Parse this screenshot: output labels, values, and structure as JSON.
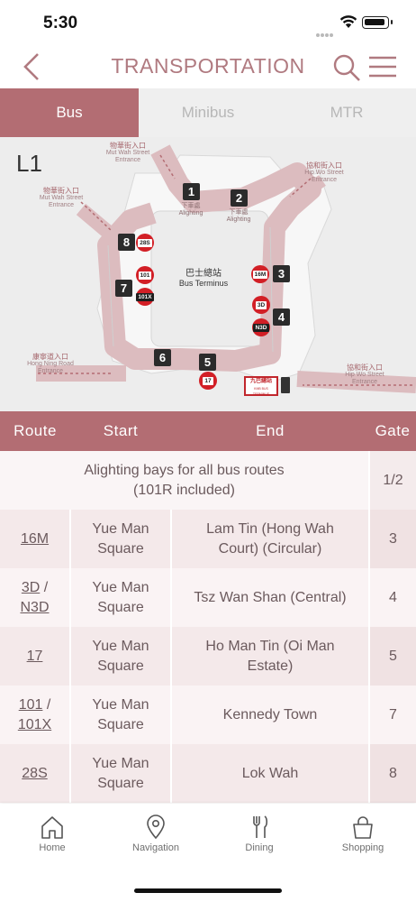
{
  "status_bar": {
    "time": "5:30"
  },
  "header": {
    "title": "TRANSPORTATION"
  },
  "tabs": [
    {
      "label": "Bus",
      "active": true
    },
    {
      "label": "Minibus",
      "active": false
    },
    {
      "label": "MTR",
      "active": false
    }
  ],
  "map": {
    "floor": "L1",
    "terminus": {
      "zh": "巴士總站",
      "en": "Bus Terminus"
    },
    "entrances": [
      {
        "zh": "物華街入口",
        "en1": "Mut Wah Street",
        "en2": "Entrance"
      },
      {
        "zh": "物華街入口",
        "en1": "Mut Wah Street",
        "en2": "Entrance"
      },
      {
        "zh": "協和街入口",
        "en1": "Hip Wo Street",
        "en2": "Entrance"
      },
      {
        "zh": "康寧道入口",
        "en1": "Hong Ning Road",
        "en2": "Entrance"
      },
      {
        "zh": "協和街入口",
        "en1": "Hip Wo Street",
        "en2": "Entrance"
      }
    ],
    "alighting": {
      "zh": "下車處",
      "en": "Alighting"
    },
    "gates": [
      "1",
      "2",
      "3",
      "4",
      "5",
      "6",
      "7",
      "8"
    ],
    "route_signs": [
      "28S",
      "101",
      "101X",
      "16M",
      "3D",
      "N3D",
      "17"
    ],
    "brand": {
      "zh": "九巴總站",
      "en": "KMB BUS TERMINUS"
    }
  },
  "table": {
    "headers": {
      "route": "Route",
      "start": "Start",
      "end": "End",
      "gate": "Gate"
    },
    "note": {
      "line1": "Alighting bays for all bus routes",
      "line2": "(101R included)",
      "gate": "1/2"
    },
    "rows": [
      {
        "route1": "16M",
        "sep": "",
        "route2": "",
        "start1": "Yue Man",
        "start2": "Square",
        "end1": "Lam Tin (Hong Wah",
        "end2": "Court) (Circular)",
        "gate": "3"
      },
      {
        "route1": "3D",
        "sep": " /",
        "route2": "N3D",
        "start1": "Yue Man",
        "start2": "Square",
        "end1": "Tsz Wan Shan (Central)",
        "end2": "",
        "gate": "4"
      },
      {
        "route1": "17",
        "sep": "",
        "route2": "",
        "start1": "Yue Man",
        "start2": "Square",
        "end1": "Ho Man Tin (Oi Man",
        "end2": "Estate)",
        "gate": "5"
      },
      {
        "route1": "101",
        "sep": " /",
        "route2": "101X",
        "start1": "Yue Man",
        "start2": "Square",
        "end1": "Kennedy Town",
        "end2": "",
        "gate": "7"
      },
      {
        "route1": "28S",
        "sep": "",
        "route2": "",
        "start1": "Yue Man",
        "start2": "Square",
        "end1": "Lok Wah",
        "end2": "",
        "gate": "8"
      }
    ]
  },
  "bottom_nav": [
    {
      "label": "Home",
      "icon": "home-icon"
    },
    {
      "label": "Navigation",
      "icon": "location-pin-icon"
    },
    {
      "label": "Dining",
      "icon": "fork-knife-icon"
    },
    {
      "label": "Shopping",
      "icon": "shopping-bag-icon"
    }
  ],
  "colors": {
    "accent": "#b36d73",
    "title": "#b07a80",
    "route_sign_red": "#d21f26"
  }
}
